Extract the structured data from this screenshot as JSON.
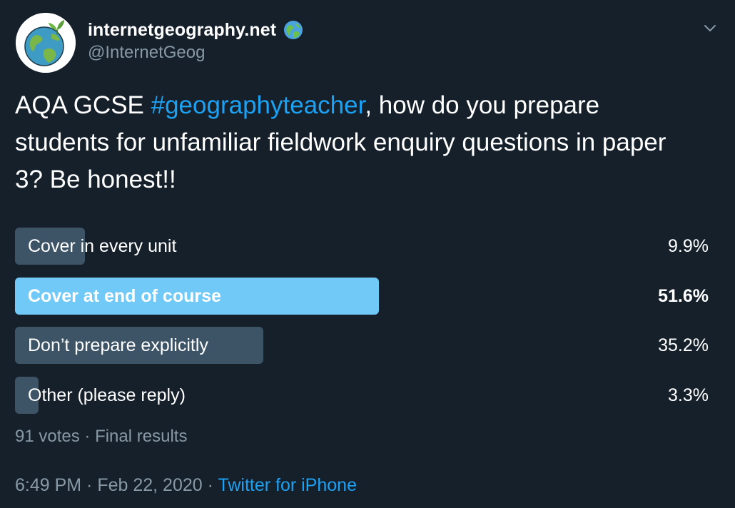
{
  "author": {
    "display_name": "internetgeography.net",
    "handle": "@InternetGeog",
    "avatar_icon": "globe-plant-avatar",
    "badge_icon": "earth-globe-emoji"
  },
  "tweet": {
    "text_prefix": "AQA GCSE ",
    "hashtag": "#geographyteacher",
    "text_suffix": ", how do you prepare students for unfamiliar fieldwork enquiry questions in paper 3? Be honest!!"
  },
  "poll": {
    "options": [
      {
        "label": "Cover in every unit",
        "percent_text": "9.9%",
        "percent": 9.9,
        "winner": false
      },
      {
        "label": "Cover at end of course",
        "percent_text": "51.6%",
        "percent": 51.6,
        "winner": true
      },
      {
        "label": "Don’t prepare explicitly",
        "percent_text": "35.2%",
        "percent": 35.2,
        "winner": false
      },
      {
        "label": "Other (please reply)",
        "percent_text": "3.3%",
        "percent": 3.3,
        "winner": false
      }
    ],
    "votes_text": "91 votes",
    "separator": " · ",
    "status_text": "Final results"
  },
  "footer": {
    "time": "6:49 PM",
    "separator": " · ",
    "date": "Feb 22, 2020",
    "source": "Twitter for iPhone"
  },
  "colors": {
    "background": "#15202b",
    "secondary_text": "#8899a6",
    "accent": "#1da1f2",
    "poll_bar": "#3d5466",
    "poll_bar_winner": "#71c9f8"
  }
}
